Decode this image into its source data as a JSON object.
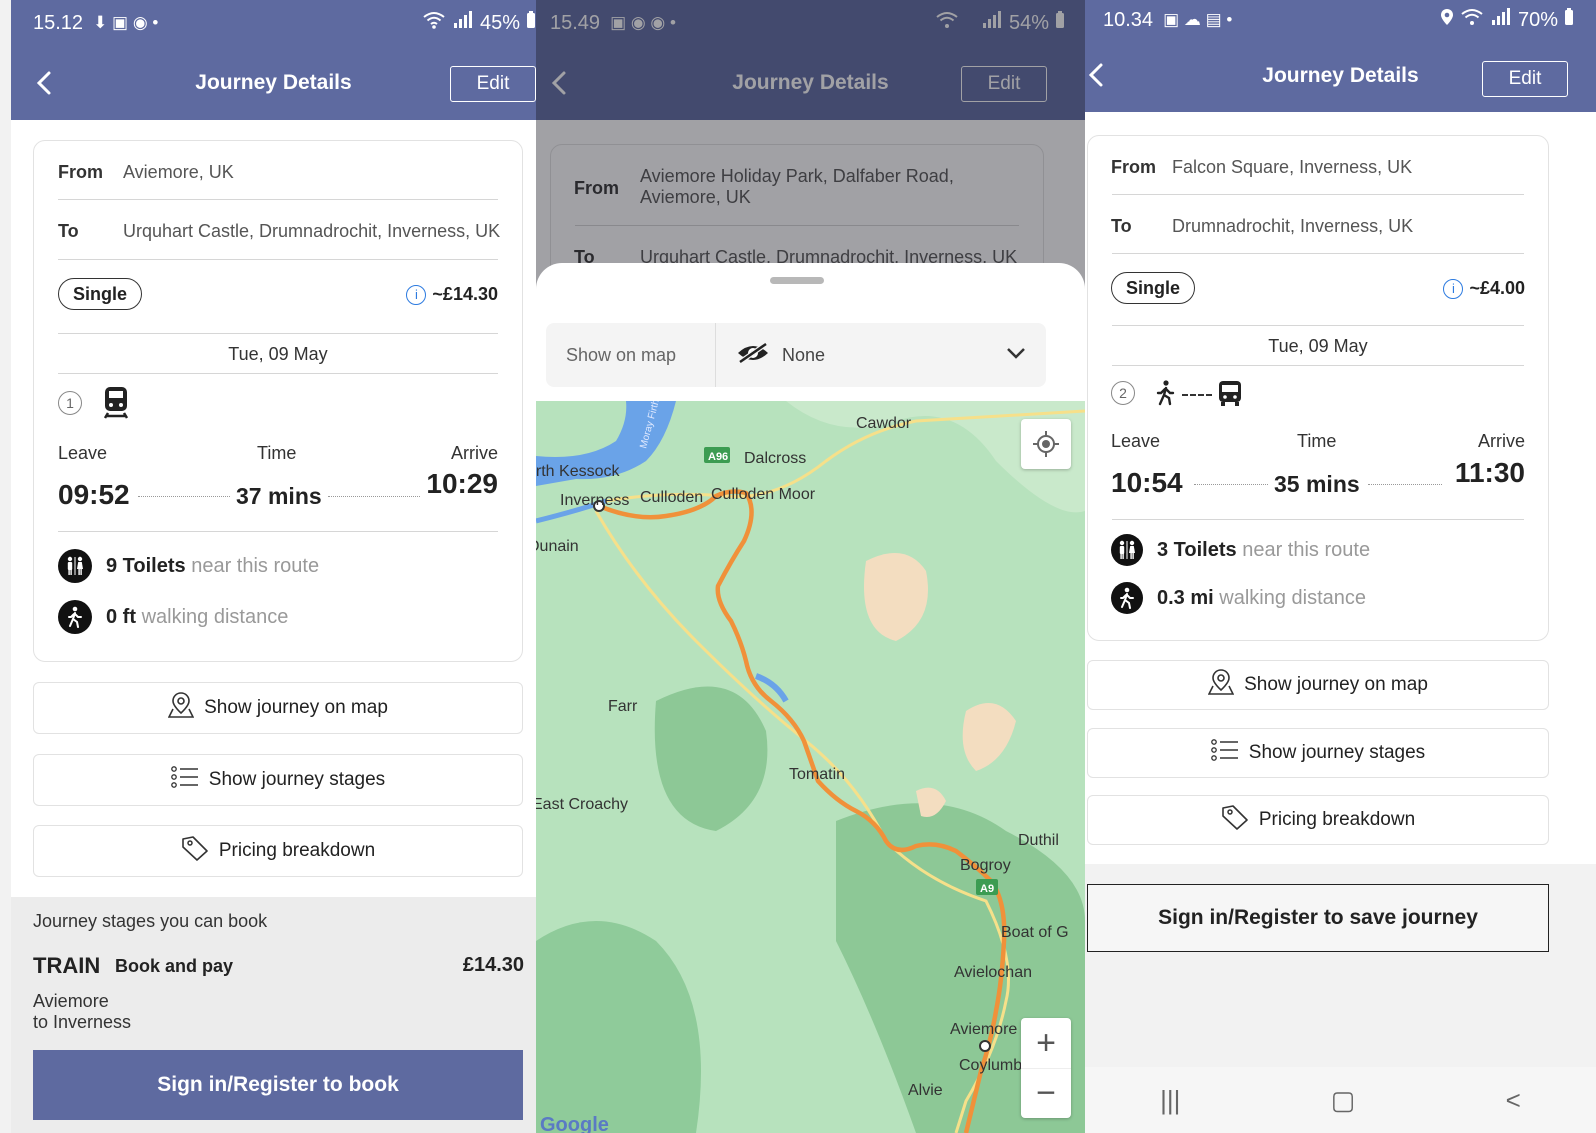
{
  "panels": [
    {
      "status": {
        "time": "15.12",
        "icons_left": "⬇ ▣ ◉ •",
        "icons_right": "",
        "battery": "45%"
      },
      "appbar": {
        "title": "Journey Details",
        "edit": "Edit"
      },
      "journey": {
        "from_label": "From",
        "from": "Aviemore, UK",
        "to_label": "To",
        "to": "Urquhart Castle, Drumnadrochit, Inverness, UK",
        "ticket": "Single",
        "price": "~£14.30",
        "date": "Tue, 09 May",
        "stage_count": "1",
        "leave_label": "Leave",
        "time_label": "Time",
        "arrive_label": "Arrive",
        "leave": "09:52",
        "duration": "37 mins",
        "arrive": "10:29",
        "toilets_count": "9 Toilets",
        "toilets_text": "near this route",
        "walk_count": "0 ft",
        "walk_text": "walking distance"
      },
      "actions": {
        "map": "Show journey on map",
        "stages": "Show journey stages",
        "pricing": "Pricing breakdown"
      },
      "booking": {
        "heading": "Journey stages you can book",
        "mode": "TRAIN",
        "book": "Book and pay",
        "amount": "£14.30",
        "route_from": "Aviemore",
        "route_to": "to Inverness",
        "cta": "Sign in/Register to book"
      }
    },
    {
      "status": {
        "time": "15.49",
        "icons_left": "▣ ◉ ◉ •",
        "battery": "54%"
      },
      "appbar": {
        "title": "Journey Details",
        "edit": "Edit"
      },
      "journey": {
        "from_label": "From",
        "from_line1": "Aviemore Holiday Park, Dalfaber Road,",
        "from_line2": "Aviemore, UK",
        "to_label": "To",
        "to": "Urquhart Castle, Drumnadrochit, Inverness, UK"
      },
      "sheet": {
        "show_on_map": "Show on map",
        "selected": "None"
      },
      "map": {
        "places": [
          "Cawdor",
          "Dalcross",
          "orth Kessock",
          "Inverness",
          "Culloden",
          "Culloden Moor",
          "Dunain",
          "Farr",
          "Tomatin",
          "East Croachy",
          "Duthil",
          "Bogroy",
          "Boat of G",
          "Avielochan",
          "Aviemore",
          "Coylumbridge",
          "Alvie",
          "Moray Firth"
        ],
        "roads": [
          "A96",
          "A9"
        ],
        "zoom_in": "+",
        "zoom_out": "−",
        "attribution": "Google"
      }
    },
    {
      "status": {
        "time": "10.34",
        "icons_left": "▣ ☁ ▤ •",
        "battery": "70%"
      },
      "appbar": {
        "title": "Journey Details",
        "edit": "Edit"
      },
      "journey": {
        "from_label": "From",
        "from": "Falcon Square, Inverness, UK",
        "to_label": "To",
        "to": "Drumnadrochit, Inverness, UK",
        "ticket": "Single",
        "price": "~£4.00",
        "date": "Tue, 09 May",
        "stage_count": "2",
        "leave_label": "Leave",
        "time_label": "Time",
        "arrive_label": "Arrive",
        "leave": "10:54",
        "duration": "35 mins",
        "arrive": "11:30",
        "toilets_count": "3 Toilets",
        "toilets_text": "near this route",
        "walk_count": "0.3 mi",
        "walk_text": "walking distance"
      },
      "actions": {
        "map": "Show journey on map",
        "stages": "Show journey stages",
        "pricing": "Pricing breakdown"
      },
      "cta": "Sign in/Register to save journey",
      "sysnav": {
        "recents": "|||",
        "home": "▢",
        "back": "<"
      }
    }
  ],
  "colors": {
    "navy": "#5e6aa0",
    "route": "#f0913a",
    "map_green": "#a8dcb2",
    "water": "#6aa3e8"
  }
}
